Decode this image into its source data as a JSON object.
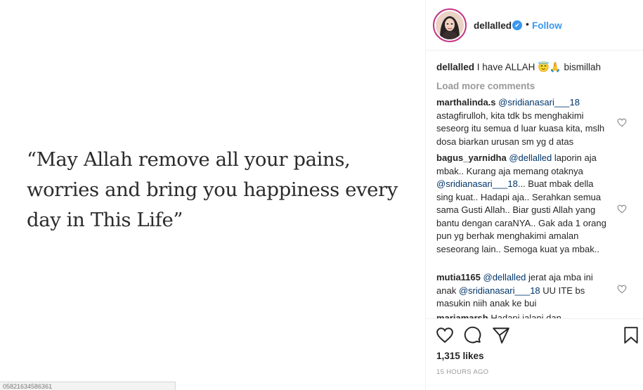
{
  "post": {
    "quote_line1": "“May Allah remove all your pains,",
    "quote_line2": "worries and bring you happiness every",
    "quote_line3": "day in This Life”"
  },
  "status_bar": {
    "url": "05821634586361"
  },
  "header": {
    "username": "dellalled",
    "verified_mark": "✔",
    "separator": "•",
    "follow_label": "Follow"
  },
  "caption": {
    "author": "dellalled",
    "text": "I have ALLAH 😇🙏 bismillah"
  },
  "load_more": "Load more comments",
  "comments": [
    {
      "author": "marthalinda.s",
      "mention": "@sridianasari___18",
      "text": "astagfirulloh, kita tdk bs menghakimi seseorg itu semua d luar kuasa kita, mslh dosa biarkan urusan sm yg d atas"
    },
    {
      "author": "bagus_yarnidha",
      "mention": "@dellalled",
      "text_before": "laporin aja mbak.. Kurang aja memang otaknya",
      "mention2": "@sridianasari___18",
      "text_after": "... Buat mbak della sing kuat.. Hadapi aja.. Serahkan semua sama Gusti Allah.. Biar gusti Allah yang bantu dengan caraNYA.. Gak ada 1 orang pun yg berhak menghakimi amalan seseorang lain.. Semoga kuat ya mbak.."
    },
    {
      "author": "mutia1165",
      "mention": "@dellalled",
      "text_before": "jerat aja mba ini anak",
      "mention2": "@sridianasari___18",
      "text_after": "UU ITE bs masukin niih anak ke bui"
    },
    {
      "author": "mariamarsh",
      "text": "Hadapi jalani dan"
    }
  ],
  "actions": {
    "likes": "1,315 likes",
    "timestamp": "15 HOURS AGO"
  },
  "colors": {
    "accent": "#3897f0",
    "mention": "#003569",
    "muted": "#999999",
    "text": "#262626"
  }
}
